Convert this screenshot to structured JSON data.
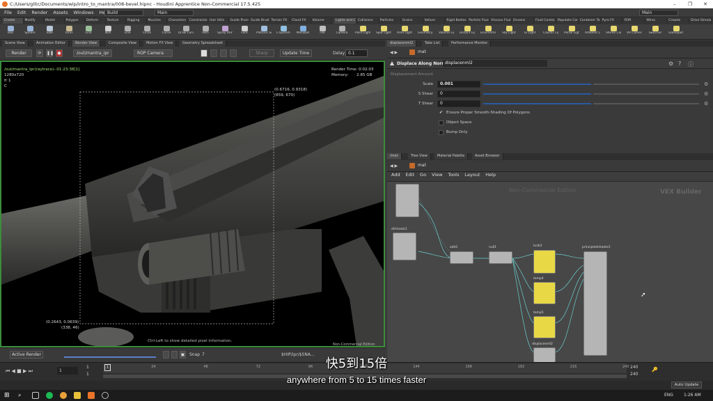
{
  "window": {
    "title": "C:/Users/glitc/Documents/wip/intro_to_mantra/008-bevel.hipnc - Houdini Apprentice Non-Commercial 17.5.425"
  },
  "menubar": {
    "items": [
      "File",
      "Edit",
      "Render",
      "Assets",
      "Windows",
      "Help"
    ],
    "build_drop": "Build",
    "main_drop": "Main",
    "right_main_drop": "Main"
  },
  "shelf": {
    "left_tabs": [
      "Create",
      "Modify",
      "Model",
      "Polygon",
      "Deform",
      "Texture",
      "Rigging",
      "Muscles",
      "Characters",
      "Constraints",
      "Hair Utils",
      "Guide Process",
      "Guide Brushes",
      "Terrain FX",
      "Cloud FX",
      "Volume"
    ],
    "right_tabs": [
      "Lights and C...",
      "Collisions",
      "Particles",
      "Grains",
      "Vellum",
      "Rigid Bodies",
      "Particle Fluids",
      "Viscous Fluids",
      "Oceans",
      "Fluid Contai...",
      "Populate Con...",
      "Container Tools",
      "Pyro FX",
      "FEM",
      "Wires",
      "Crowds",
      "Drive Simula..."
    ],
    "left_tools": [
      "Box",
      "Sphere",
      "Tube",
      "Torus",
      "Grid",
      "Null",
      "Line",
      "Circle",
      "Curve",
      "Draw Curve",
      "Path",
      "Spray Paint",
      "Font",
      "Platonic Solids",
      "L-System",
      "Metaball",
      "File"
    ],
    "right_tools": [
      "Camera",
      "Point Light",
      "Spot Light",
      "Area Light",
      "Geometry Light",
      "Volume Light",
      "Distant Light",
      "Environment Light",
      "Sky Light",
      "GI Light",
      "Caustic Light",
      "Portal Light",
      "Ambient Light",
      "Stereo Camera",
      "VR Camera",
      "Switcher",
      "Gamepad Camera"
    ]
  },
  "left_panel": {
    "tabs": [
      "Scene View",
      "Animation Editor",
      "Render View",
      "Composite View",
      "Motion FX View",
      "Geometry Spreadsheet"
    ],
    "render_button": "Render",
    "out_path": "/out/mantra_ipr",
    "camera": "ROP Camera",
    "sharp": "Sharp",
    "update_time": "Update Time",
    "delay_label": "Delay",
    "delay_value": "0.1",
    "viewport": {
      "render_name": "/out/mantra_ipr(raytrace)--01:23:38[1]",
      "resolution": "1280x720",
      "fr": "fr 1",
      "channel": "C",
      "render_time": "Render Time: 0:02:03",
      "memory_label": "Memory:",
      "memory_value": "2.85 GB",
      "coord_tr": "(0.6716, 0.9318)",
      "pix_tr": "(859, 670)",
      "coord_bl": "(0.2643, 0.0639)",
      "pix_bl": "(338, 46)",
      "hint": "Ctrl-Left to show detailed pixel information.",
      "edition": "Non-Commercial Edition"
    },
    "bottom": {
      "active_render": "Active Render",
      "snap": "Snap",
      "snap_value": "7",
      "path": "$HIP/ipr/$SNA..."
    }
  },
  "param_pane": {
    "tabs": [
      "displacenml2",
      "Take List",
      "Performance Monitor"
    ],
    "path": "mat",
    "node_type": "Displace Along Normal",
    "node_name": "displacenml2",
    "displacement_amount_label": "Displacement Amount",
    "scale_label": "Scale",
    "scale_value": "0.001",
    "s_shear_label": "S Shear",
    "s_shear_value": "0",
    "t_shear_label": "T Shear",
    "t_shear_value": "0",
    "check1": "Ensure Proper Smooth-Shading Of Polygons",
    "check2": "Object Space",
    "check3": "Bump Only"
  },
  "network_pane": {
    "tabs": [
      "/mat",
      "Tree View",
      "Material Palette",
      "Asset Browser"
    ],
    "path": "mat",
    "menu": [
      "Add",
      "Edit",
      "Go",
      "View",
      "Tools",
      "Layout",
      "Help"
    ],
    "watermark": "Non-Commercial Edition",
    "builder_label": "VEX Builder",
    "nodes": {
      "dirtmask": "dirtmask1",
      "add": "add1",
      "null": "null1",
      "turb": "turb3",
      "temp4": "temp4",
      "temp5": "temp5",
      "principled": "principledshader2",
      "displace": "displacenml2"
    }
  },
  "timeline": {
    "frame": "1",
    "start": "1",
    "start2": "1",
    "end": "240",
    "end2": "240",
    "ticks": [
      "1",
      "24",
      "48",
      "72",
      "96",
      "120",
      "144",
      "168",
      "192",
      "216",
      "240"
    ],
    "auto_update": "Auto Update"
  },
  "subtitles": {
    "cn": "快5到15倍",
    "en": "anywhere from 5 to 15 times faster"
  },
  "taskbar": {
    "lang": "ENG",
    "time": "1:26 AM"
  }
}
